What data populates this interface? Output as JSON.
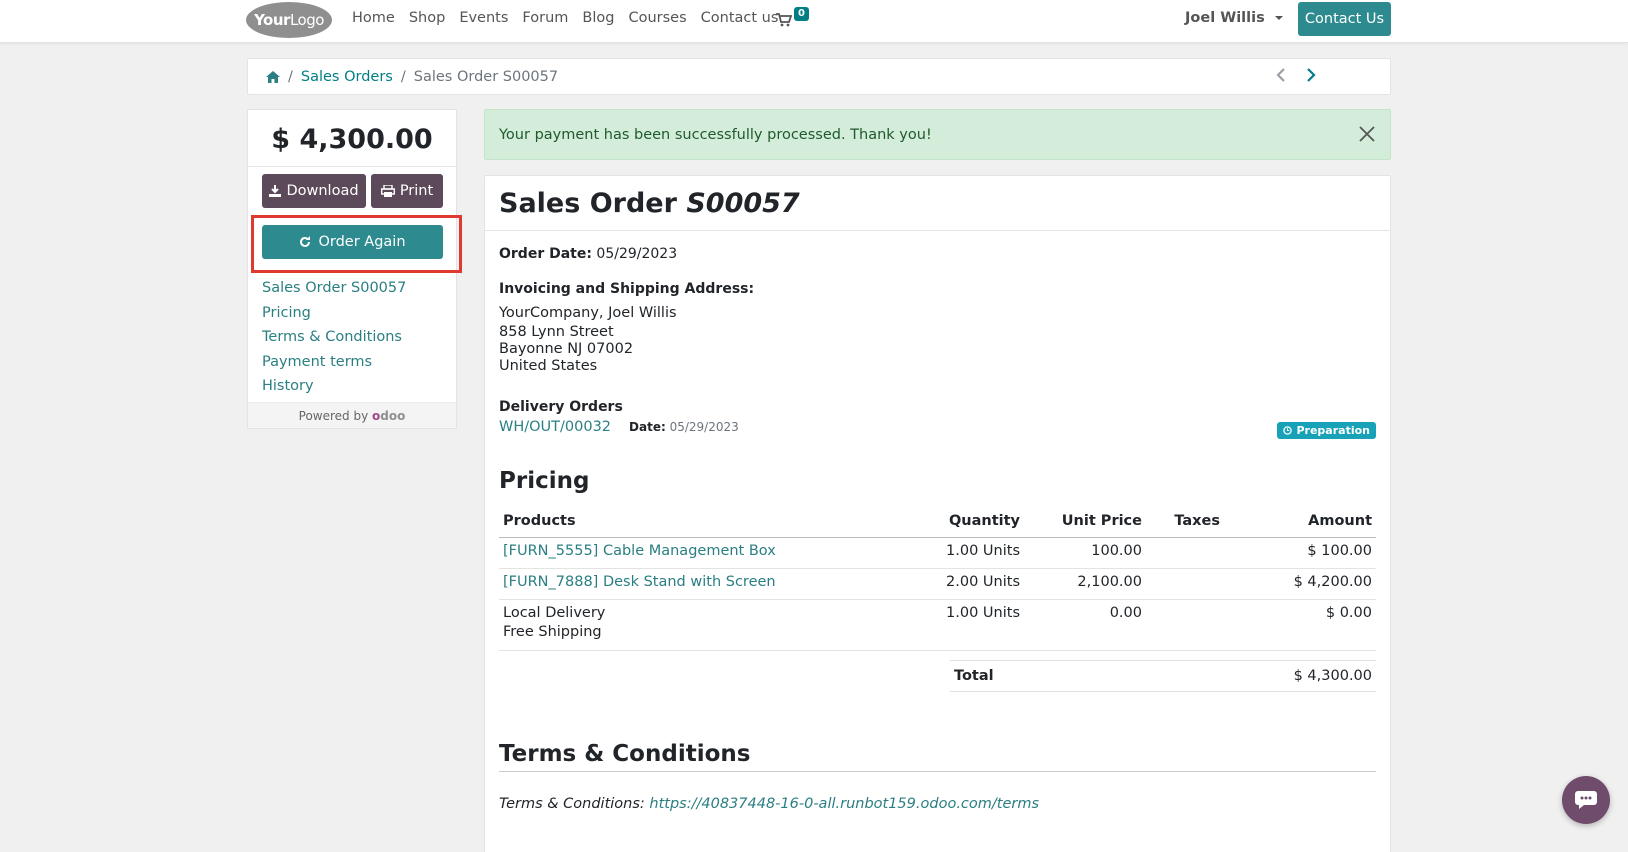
{
  "navbar": {
    "logo_bold": "Your",
    "logo_thin": "Logo",
    "links": [
      "Home",
      "Shop",
      "Events",
      "Forum",
      "Blog",
      "Courses",
      "Contact us"
    ],
    "cart_count": "0",
    "user_name": "Joel Willis",
    "contact_button": "Contact Us"
  },
  "breadcrumb": {
    "items": [
      "Sales Orders"
    ],
    "current": "Sales Order S00057"
  },
  "sidebar": {
    "amount": "$ 4,300.00",
    "download_label": "Download",
    "print_label": "Print",
    "order_again_label": "Order Again",
    "links": [
      "Sales Order S00057",
      "Pricing",
      "Terms & Conditions",
      "Payment terms",
      "History"
    ],
    "powered_by": "Powered by",
    "odoo_o": "o",
    "odoo_rest": "doo"
  },
  "alert": {
    "message": "Your payment has been successfully processed. Thank you!"
  },
  "order": {
    "title_prefix": "Sales Order",
    "title_number": "S00057",
    "order_date_label": "Order Date:",
    "order_date": "05/29/2023",
    "address_label": "Invoicing and Shipping Address:",
    "address_lines": [
      "YourCompany, Joel Willis",
      "858 Lynn Street",
      "Bayonne NJ 07002",
      "United States"
    ],
    "delivery_label": "Delivery Orders",
    "delivery_ref": "WH/OUT/00032",
    "delivery_date_label": "Date:",
    "delivery_date": "05/29/2023",
    "delivery_status": "Preparation"
  },
  "pricing": {
    "heading": "Pricing",
    "columns": [
      "Products",
      "Quantity",
      "Unit Price",
      "Taxes",
      "Amount"
    ],
    "rows": [
      {
        "product": "[FURN_5555] Cable Management Box",
        "product2": "",
        "link": true,
        "qty": "1.00 Units",
        "price": "100.00",
        "taxes": "",
        "amount": "$ 100.00"
      },
      {
        "product": "[FURN_7888] Desk Stand with Screen",
        "product2": "",
        "link": true,
        "qty": "2.00 Units",
        "price": "2,100.00",
        "taxes": "",
        "amount": "$ 4,200.00"
      },
      {
        "product": "Local Delivery",
        "product2": "Free Shipping",
        "link": false,
        "qty": "1.00 Units",
        "price": "0.00",
        "taxes": "",
        "amount": "$ 0.00"
      }
    ],
    "total_label": "Total",
    "total_value": "$ 4,300.00"
  },
  "terms": {
    "heading": "Terms & Conditions",
    "label": "Terms & Conditions:",
    "url": "https://40837448-16-0-all.runbot159.odoo.com/terms"
  },
  "colors": {
    "primary": "#2d8b8f",
    "link": "#2a7f83",
    "dark_button": "#5c4a5a",
    "highlight": "#e0392f",
    "success_bg": "#d4eddb"
  }
}
